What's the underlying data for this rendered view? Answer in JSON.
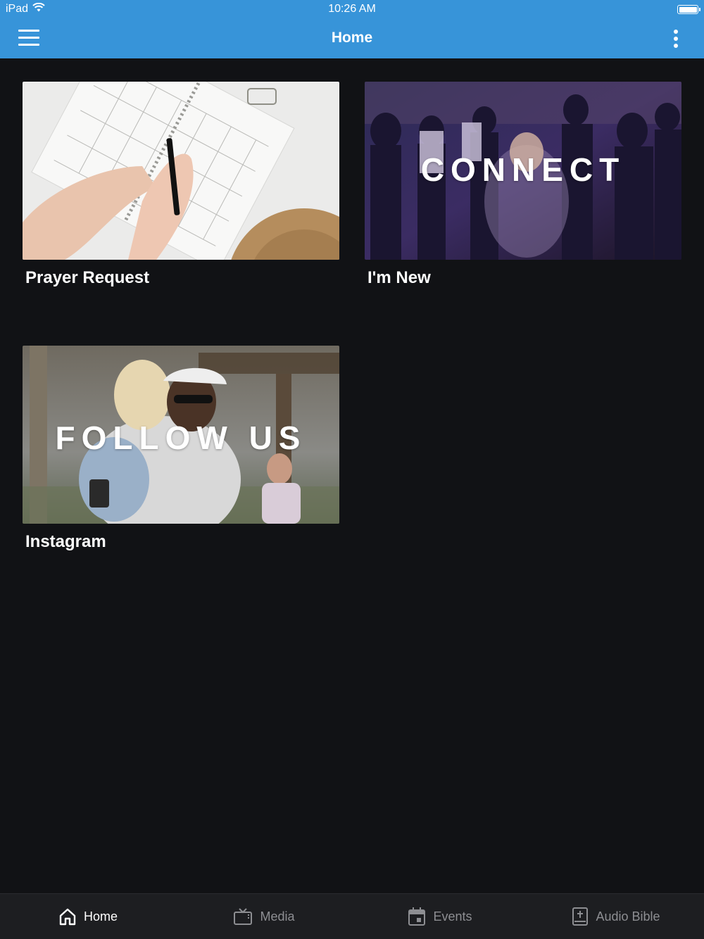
{
  "status_bar": {
    "carrier": "iPad",
    "time": "10:26 AM"
  },
  "app_bar": {
    "title": "Home",
    "menu_icon": "hamburger-menu-icon",
    "more_icon": "more-vertical-icon",
    "color": "#3794d9"
  },
  "tiles": [
    {
      "label": "Prayer Request",
      "image": "notebook-calendar-hands-photo",
      "overlay": ""
    },
    {
      "label": "I'm New",
      "image": "church-worship-crowd-photo",
      "overlay": "CONNECT"
    },
    {
      "label": "Instagram",
      "image": "people-hugging-photo",
      "overlay": "FOLLOW US"
    }
  ],
  "bottom_nav": [
    {
      "label": "Home",
      "icon": "home-icon",
      "active": true
    },
    {
      "label": "Media",
      "icon": "tv-icon",
      "active": false
    },
    {
      "label": "Events",
      "icon": "calendar-icon",
      "active": false
    },
    {
      "label": "Audio Bible",
      "icon": "bible-icon",
      "active": false
    }
  ],
  "colors": {
    "background": "#111215",
    "nav_background": "#1d1e21",
    "inactive": "#8d8e92"
  }
}
